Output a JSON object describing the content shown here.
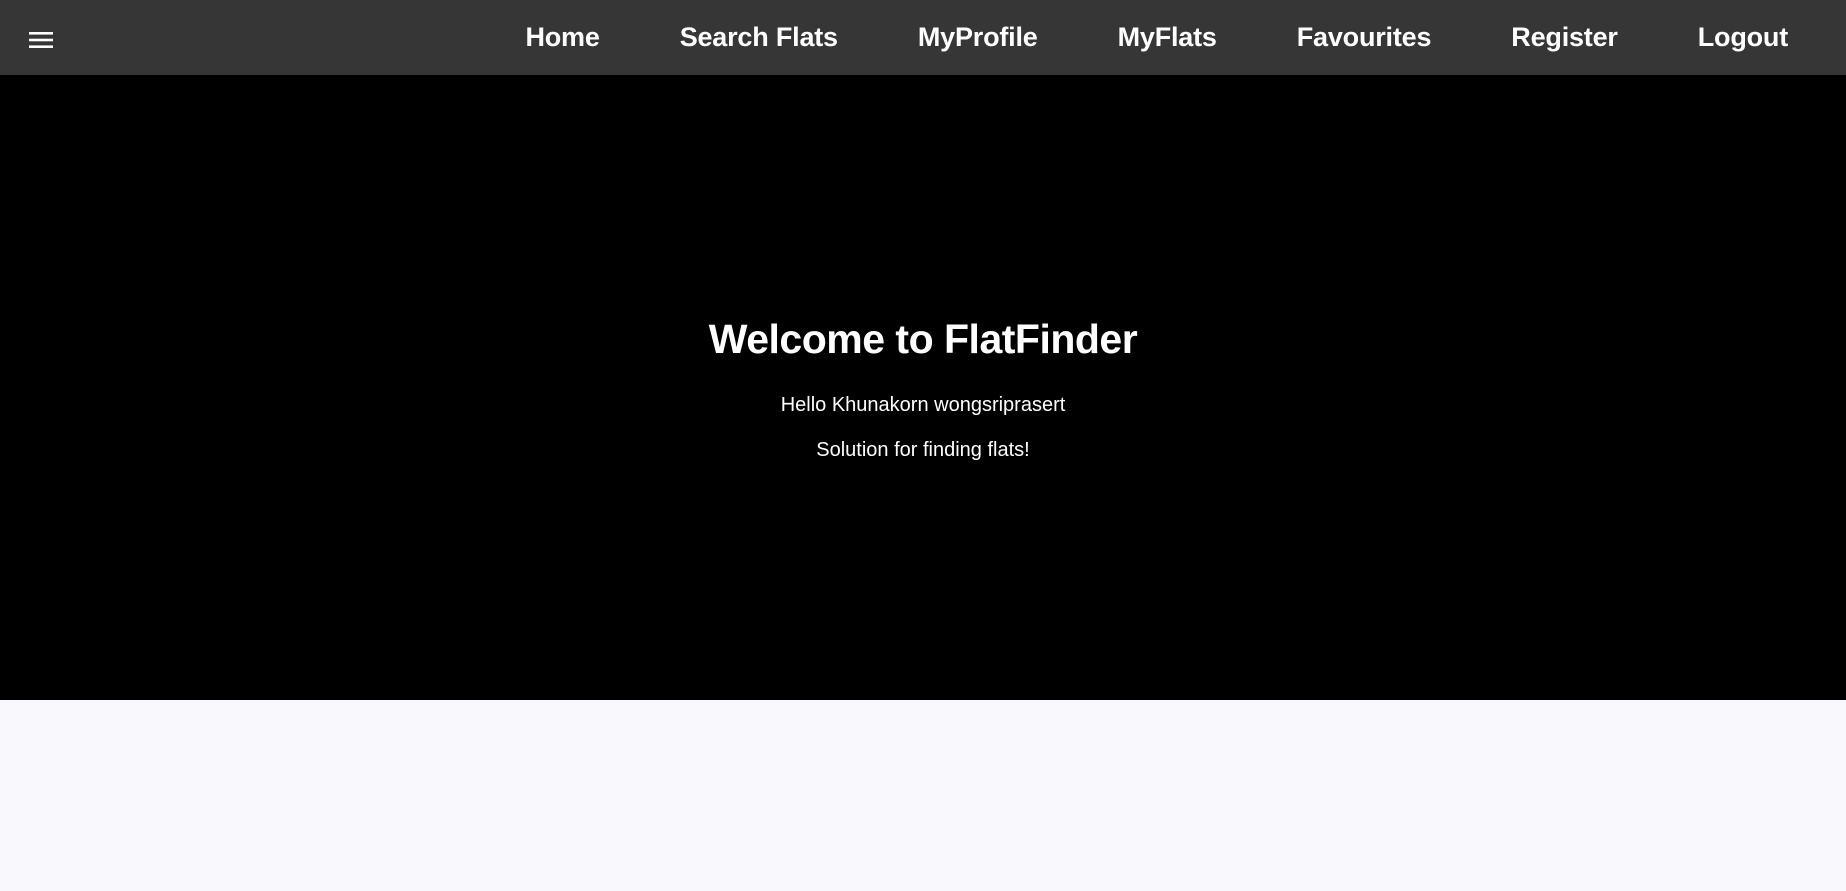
{
  "nav": {
    "menu_icon": "hamburger-menu-icon",
    "links": [
      {
        "label": "Home"
      },
      {
        "label": "Search Flats"
      },
      {
        "label": "MyProfile"
      },
      {
        "label": "MyFlats"
      },
      {
        "label": "Favourites"
      },
      {
        "label": "Register"
      },
      {
        "label": "Logout"
      }
    ]
  },
  "hero": {
    "title": "Welcome to FlatFinder",
    "greeting": "Hello Khunakorn wongsriprasert",
    "tagline": "Solution for finding flats!"
  },
  "colors": {
    "navbar_bg": "#363636",
    "hero_bg": "#000000",
    "page_bg": "#f8f8fd",
    "text": "#ffffff"
  }
}
